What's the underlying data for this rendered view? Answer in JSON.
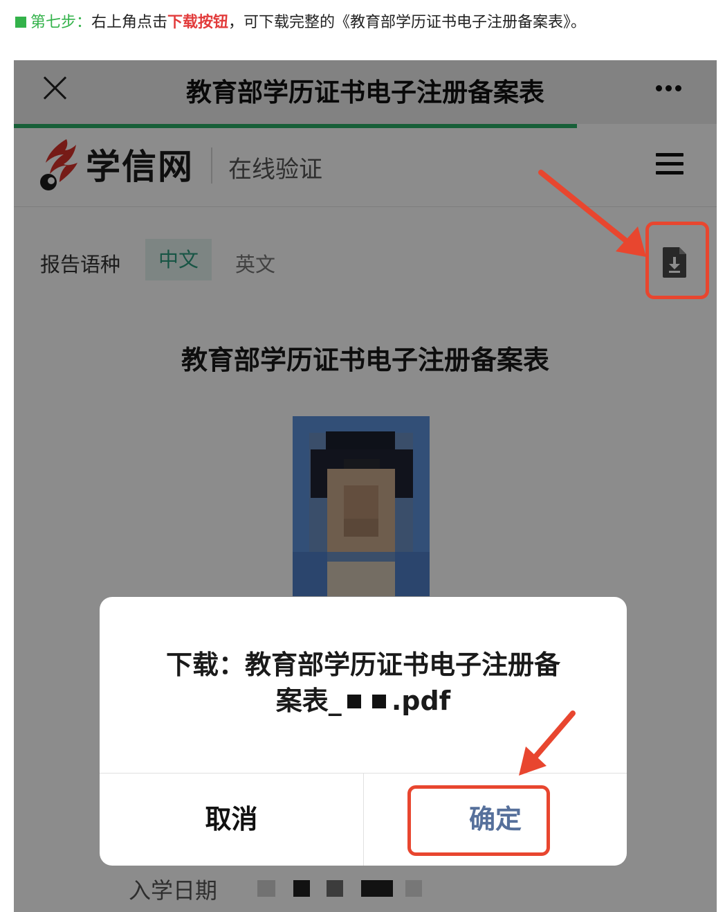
{
  "instruction": {
    "step_label": "第七步：",
    "text_before": "右上角点击",
    "highlight": "下载按钮",
    "text_after": "，可下载完整的《教育部学历证书电子注册备案表》。"
  },
  "titlebar": {
    "close_icon": "close-icon",
    "title": "教育部学历证书电子注册备案表",
    "more_icon": "more-icon"
  },
  "site": {
    "logo_text": "学信网",
    "subtitle": "在线验证",
    "menu_icon": "menu-icon"
  },
  "language": {
    "label": "报告语种",
    "options": [
      "中文",
      "英文"
    ],
    "selected": "中文",
    "download_icon": "download-icon"
  },
  "document": {
    "title": "教育部学历证书电子注册备案表",
    "enroll_label": "入学日期"
  },
  "dialog": {
    "line1": "下载：教育部学历证书电子注册备",
    "line2_prefix": "案表_",
    "line2_suffix": ".pdf",
    "cancel_label": "取消",
    "confirm_label": "确定"
  },
  "colors": {
    "step_green": "#33b24a",
    "highlight_red": "#e23b3b",
    "progress_green": "#2aae67",
    "annotation_red": "#e8462f",
    "confirm_blue": "#56709b"
  }
}
